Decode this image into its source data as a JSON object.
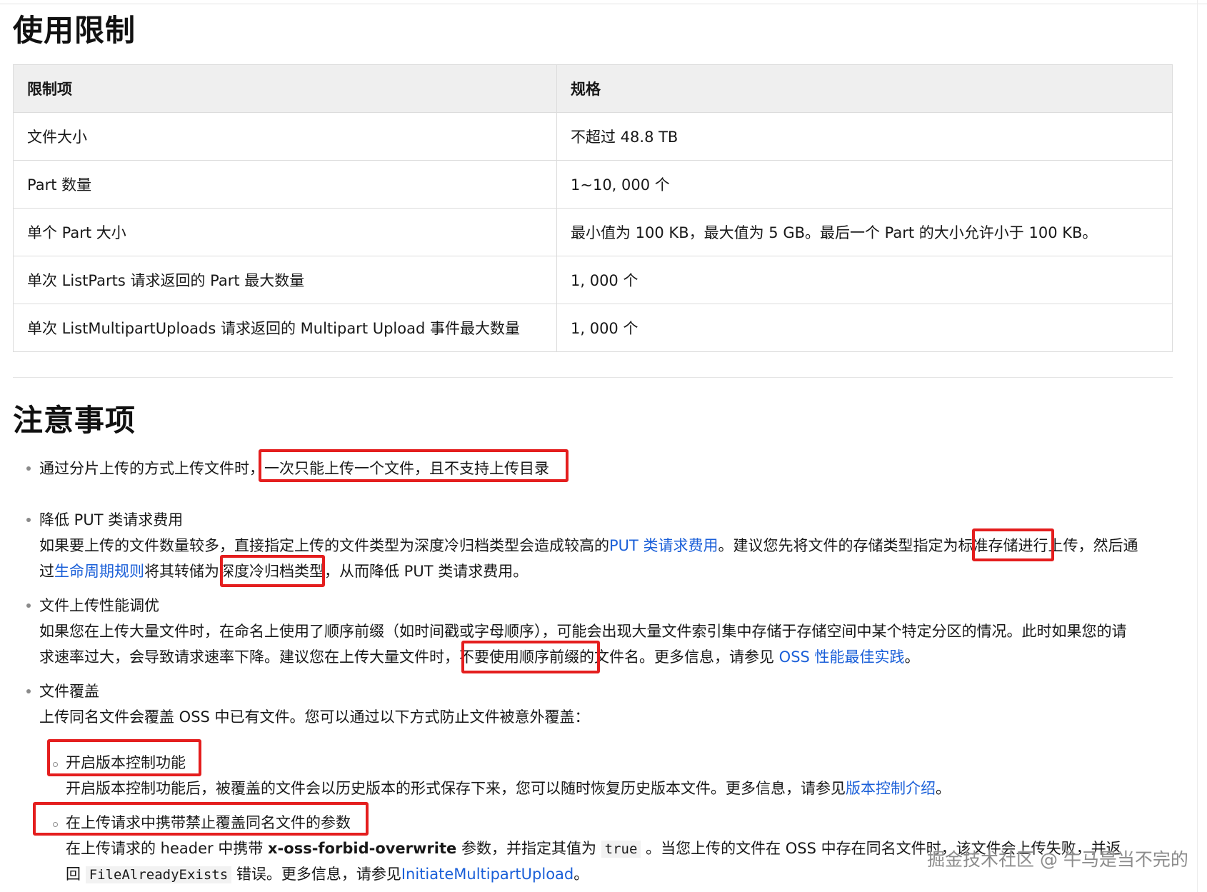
{
  "limits": {
    "title": "使用限制",
    "headers": [
      "限制项",
      "规格"
    ],
    "rows": [
      [
        "文件大小",
        "不超过 48.8 TB"
      ],
      [
        "Part 数量",
        "1~10, 000 个"
      ],
      [
        "单个 Part 大小",
        "最小值为 100 KB，最大值为 5 GB。最后一个 Part 的大小允许小于 100 KB。"
      ],
      [
        "单次 ListParts 请求返回的 Part 最大数量",
        "1, 000 个"
      ],
      [
        "单次 ListMultipartUploads 请求返回的 Multipart Upload 事件最大数量",
        "1, 000 个"
      ]
    ]
  },
  "notes": {
    "title": "注意事项",
    "item1": {
      "prefix": "通过分片上传的方式上传文件时，",
      "highlight": "一次只能上传一个文件，且不支持上传目录"
    },
    "item2": {
      "heading": "降低 PUT 类请求费用",
      "l1_a": "如果要上传的文件数量较多，直接指定上传的文件类型为深度冷归档类型会造成较高的",
      "l1_link": "PUT 类请求费用",
      "l1_b": "。建议您先将文件的存储类型指定为标准存储进行上传，然后通",
      "l2_a": "过",
      "l2_link": "生命周期规则",
      "l2_b": "将其转储为深度冷归档类型，从而降低 PUT 类请求费用。"
    },
    "item3": {
      "heading": "文件上传性能调优",
      "l1": "如果您在上传大量文件时，在命名上使用了顺序前缀（如时间戳或字母顺序），可能会出现大量文件索引集中存储于存储空间中某个特定分区的情况。此时如果您的请",
      "l2_a": "求速率过大，会导致请求速率下降。建议您在上传大量文件时，不要使用顺序前缀的文件名。更多信息，请参见 ",
      "l2_link": "OSS 性能最佳实践",
      "l2_b": "。"
    },
    "item4": {
      "heading": "文件覆盖",
      "intro": "上传同名文件会覆盖 OSS 中已有文件。您可以通过以下方式防止文件被意外覆盖：",
      "sub1": {
        "heading": "开启版本控制功能",
        "text": "开启版本控制功能后，被覆盖的文件会以历史版本的形式保存下来，您可以随时恢复历史版本文件。更多信息，请参见",
        "link": "版本控制介绍",
        "end": "。"
      },
      "sub2": {
        "heading": "在上传请求中携带禁止覆盖同名文件的参数",
        "l1_a": "在上传请求的 header 中携带 ",
        "l1_bold": "x-oss-forbid-overwrite",
        "l1_b": " 参数，并指定其值为 ",
        "l1_code": "true",
        "l1_c": " 。当您上传的文件在 OSS 中存在同名文件时，该文件会上传失败，并返",
        "l2_a": "回 ",
        "l2_code": "FileAlreadyExists",
        "l2_b": " 错误。更多信息，请参见",
        "l2_link": "InitiateMultipartUpload",
        "l2_c": "。"
      }
    }
  },
  "watermark": "掘金技术社区 @ 牛马是当不完的",
  "colors": {
    "highlight_box": "#e41e1e",
    "link": "#1a5fd8",
    "header_bg": "#efefef"
  }
}
